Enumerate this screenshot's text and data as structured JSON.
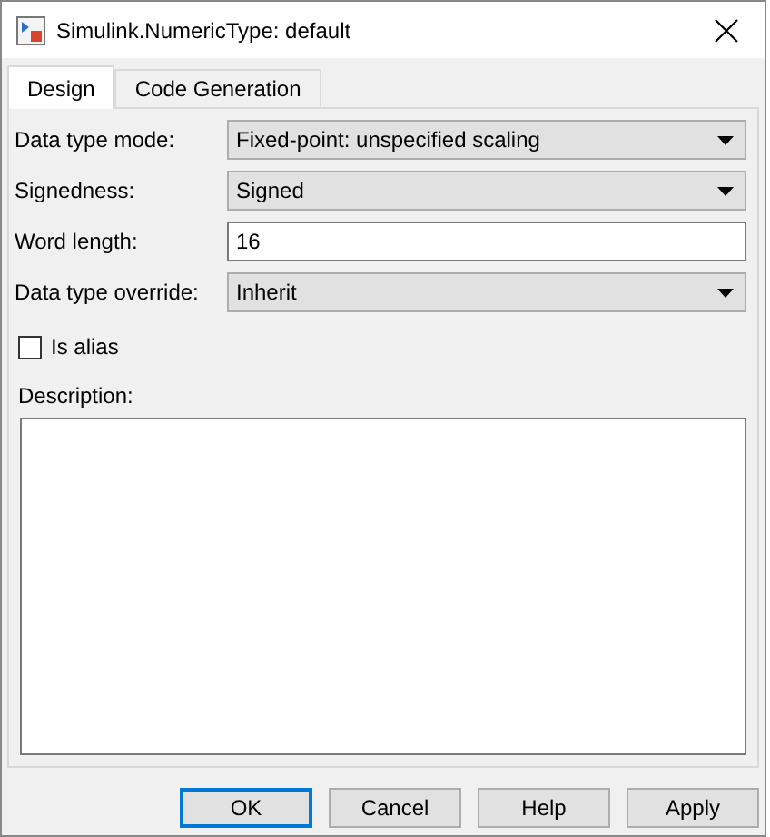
{
  "window": {
    "title": "Simulink.NumericType: default"
  },
  "tabs": [
    {
      "label": "Design",
      "selected": true
    },
    {
      "label": "Code Generation",
      "selected": false
    }
  ],
  "fields": [
    {
      "kind": "select",
      "label": "Data type mode:",
      "value": "Fixed-point: unspecified scaling"
    },
    {
      "kind": "select",
      "label": "Signedness:",
      "value": "Signed"
    },
    {
      "kind": "text",
      "label": "Word length:",
      "value": "16"
    },
    {
      "kind": "select",
      "label": "Data type override:",
      "value": "Inherit"
    }
  ],
  "is_alias": {
    "label": "Is alias",
    "checked": false
  },
  "description": {
    "label": "Description:"
  },
  "buttons": [
    {
      "label": "OK",
      "default": true
    },
    {
      "label": "Cancel",
      "default": false
    },
    {
      "label": "Help",
      "default": false
    },
    {
      "label": "Apply",
      "default": false
    }
  ]
}
